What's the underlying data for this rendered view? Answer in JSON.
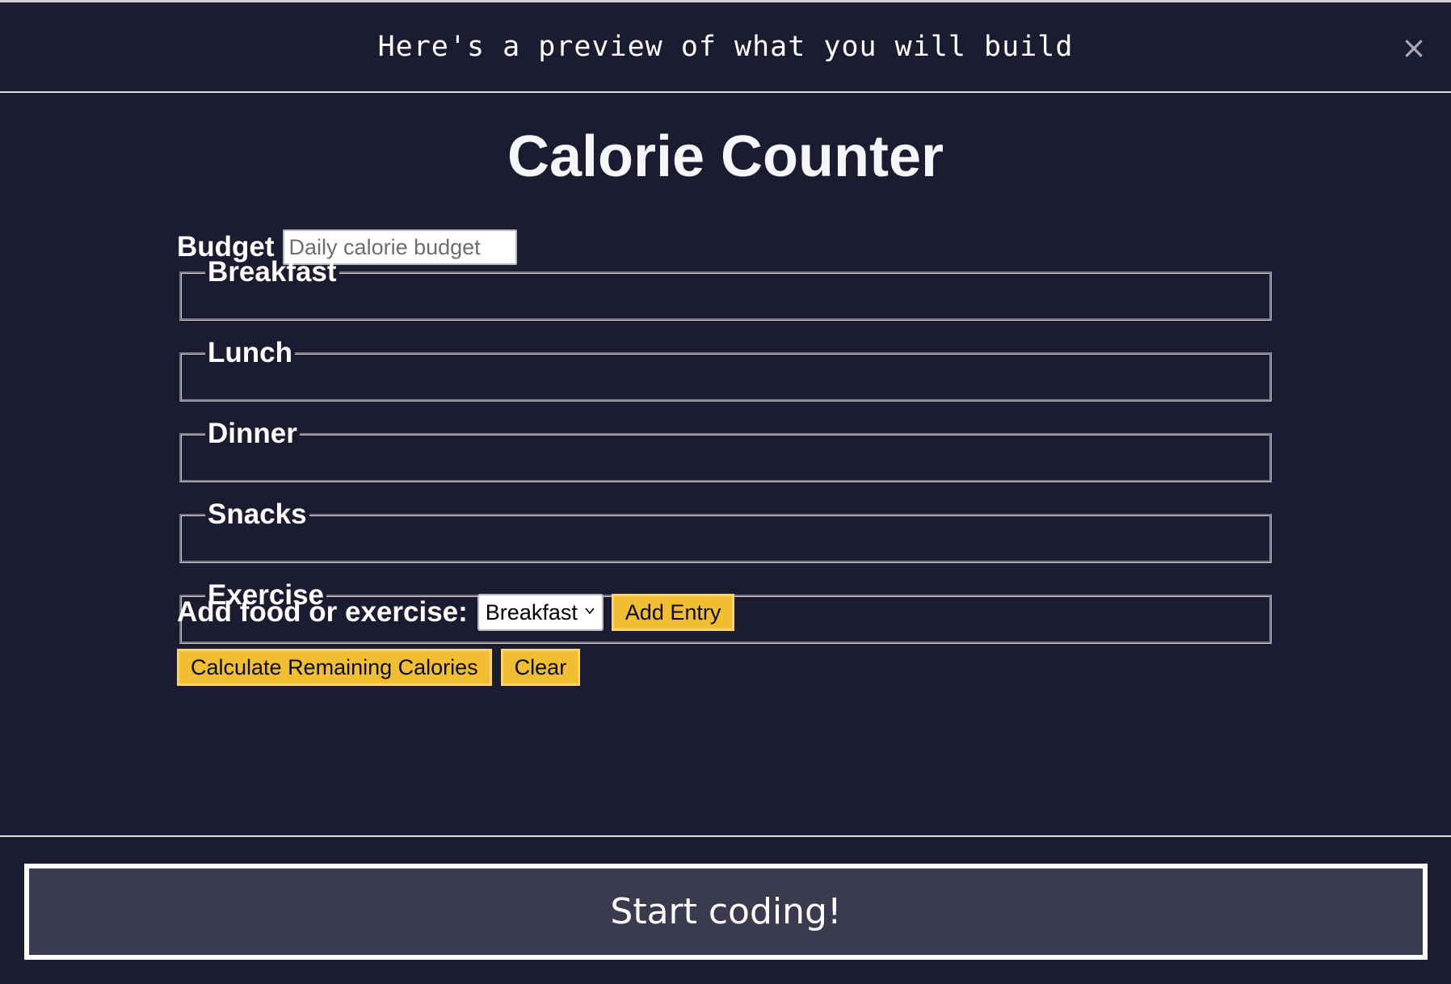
{
  "modal": {
    "title": "Here's a preview of what you will build",
    "close_icon": "close-icon",
    "close_glyph": "×"
  },
  "app": {
    "title": "Calorie Counter",
    "budget": {
      "label": "Budget",
      "placeholder": "Daily calorie budget",
      "value": ""
    },
    "sections": [
      {
        "legend": "Breakfast"
      },
      {
        "legend": "Lunch"
      },
      {
        "legend": "Dinner"
      },
      {
        "legend": "Snacks"
      },
      {
        "legend": "Exercise"
      }
    ],
    "add": {
      "label": "Add food or exercise:",
      "selected_option": "Breakfast",
      "add_button": "Add Entry"
    },
    "actions": {
      "calculate_button": "Calculate Remaining Calories",
      "clear_button": "Clear"
    }
  },
  "footer": {
    "start_button": "Start coding!"
  },
  "colors": {
    "background": "#1b1b32",
    "button_yellow": "#f1be32",
    "start_button_bg": "#3b3b4f"
  }
}
